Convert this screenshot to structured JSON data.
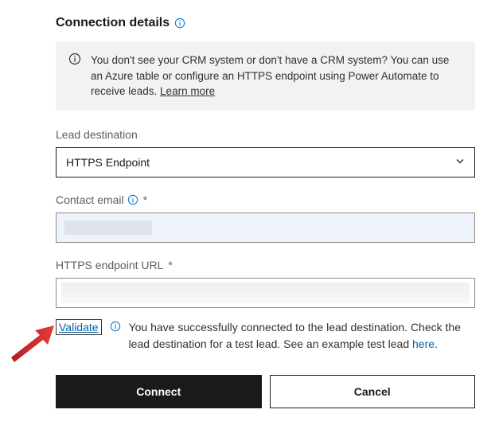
{
  "header": {
    "title": "Connection details"
  },
  "notice": {
    "text": "You don't see your CRM system or don't have a CRM system? You can use an Azure table or configure an HTTPS endpoint using Power Automate to receive leads. ",
    "link": "Learn more"
  },
  "fields": {
    "leadDestination": {
      "label": "Lead destination",
      "value": "HTTPS Endpoint"
    },
    "contactEmail": {
      "label": "Contact email",
      "required": "*"
    },
    "httpsUrl": {
      "label": "HTTPS endpoint URL",
      "required": "*"
    }
  },
  "validate": {
    "label": "Validate",
    "message_pre": "You have successfully connected to the lead destination. Check the lead destination for a test lead. See an example test lead ",
    "link": "here",
    "message_post": "."
  },
  "buttons": {
    "connect": "Connect",
    "cancel": "Cancel"
  }
}
